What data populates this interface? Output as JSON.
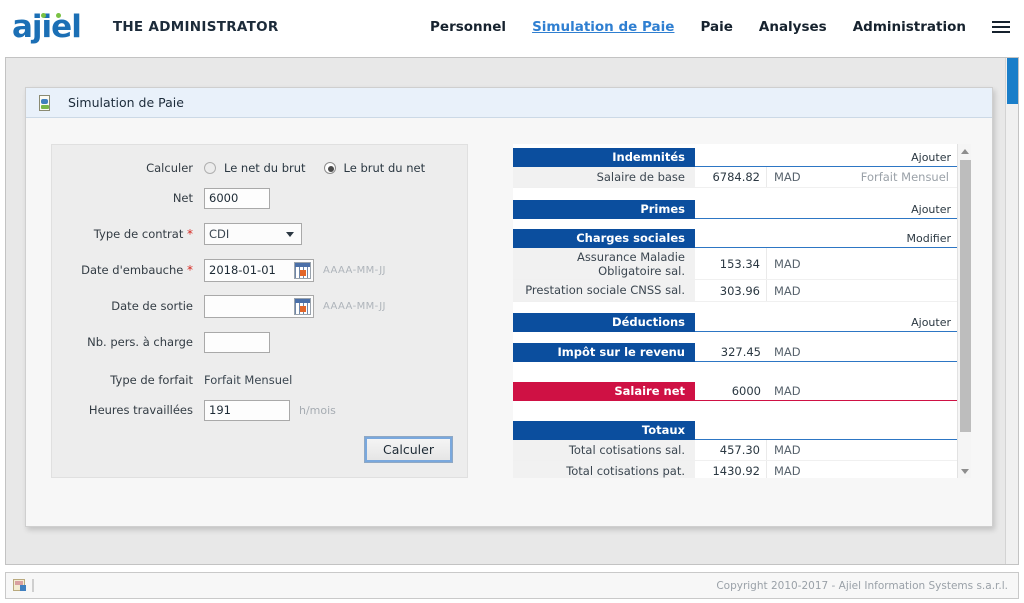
{
  "brand": {
    "logo_text": "ajiel",
    "admin_title": "THE ADMINISTRATOR"
  },
  "nav": {
    "items": [
      {
        "label": "Personnel",
        "active": false
      },
      {
        "label": "Simulation de Paie",
        "active": true
      },
      {
        "label": "Paie",
        "active": false
      },
      {
        "label": "Analyses",
        "active": false
      },
      {
        "label": "Administration",
        "active": false
      }
    ],
    "menu_icon": "hamburger-icon"
  },
  "card": {
    "title": "Simulation de Paie",
    "icon": "document-icon"
  },
  "form": {
    "calculer_label": "Calculer",
    "radio_options": [
      {
        "label": "Le net du brut",
        "selected": false
      },
      {
        "label": "Le brut du net",
        "selected": true
      }
    ],
    "net_label": "Net",
    "net_value": "6000",
    "contrat_label": "Type de contrat",
    "contrat_value": "CDI",
    "embauche_label": "Date d'embauche",
    "embauche_value": "2018-01-01",
    "embauche_hint": "AAAA-MM-JJ",
    "sortie_label": "Date de sortie",
    "sortie_value": "",
    "sortie_hint": "AAAA-MM-JJ",
    "charge_label": "Nb. pers. à charge",
    "charge_value": "",
    "forfait_label": "Type de forfait",
    "forfait_value": "Forfait Mensuel",
    "heures_label": "Heures travaillées",
    "heures_value": "191",
    "heures_unit": "h/mois",
    "submit_label": "Calculer"
  },
  "results": {
    "sections": [
      {
        "title": "Indemnités",
        "action": "Ajouter",
        "color": "#0b4e9e",
        "rows": [
          {
            "label": "Salaire de base",
            "value": "6784.82",
            "currency": "MAD",
            "extra": "Forfait Mensuel"
          }
        ]
      },
      {
        "title": "Primes",
        "action": "Ajouter",
        "color": "#0b4e9e",
        "rows": []
      },
      {
        "title": "Charges sociales",
        "action": "Modifier",
        "color": "#0b4e9e",
        "rows": [
          {
            "label": "Assurance Maladie Obligatoire sal.",
            "value": "153.34",
            "currency": "MAD",
            "extra": ""
          },
          {
            "label": "Prestation sociale CNSS sal.",
            "value": "303.96",
            "currency": "MAD",
            "extra": ""
          }
        ]
      },
      {
        "title": "Déductions",
        "action": "Ajouter",
        "color": "#0b4e9e",
        "rows": []
      }
    ],
    "impot": {
      "title": "Impôt sur le revenu",
      "value": "327.45",
      "currency": "MAD",
      "color": "#0b4e9e"
    },
    "net": {
      "title": "Salaire net",
      "value": "6000",
      "currency": "MAD",
      "color": "#cf1144"
    },
    "totaux": {
      "title": "Totaux",
      "color": "#0b4e9e",
      "rows": [
        {
          "label": "Total cotisations sal.",
          "value": "457.30",
          "currency": "MAD"
        },
        {
          "label": "Total cotisations pat.",
          "value": "1430.92",
          "currency": "MAD"
        }
      ]
    }
  },
  "footer": {
    "copyright": "Copyright 2010-2017 - Ajiel Information Systems s.a.r.l.",
    "icon": "report-icon"
  }
}
